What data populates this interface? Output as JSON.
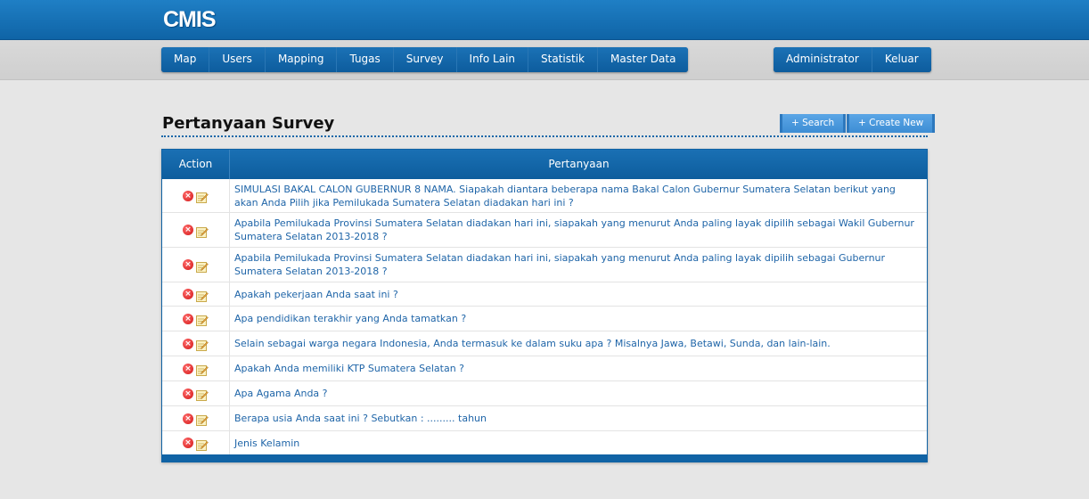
{
  "app": {
    "logo": "CMIS"
  },
  "nav": {
    "left": [
      "Map",
      "Users",
      "Mapping",
      "Tugas",
      "Survey",
      "Info Lain",
      "Statistik",
      "Master Data"
    ],
    "right": [
      "Administrator",
      "Keluar"
    ]
  },
  "page": {
    "title": "Pertanyaan Survey",
    "search_button": "+ Search",
    "create_button": "+ Create New"
  },
  "table": {
    "headers": {
      "action": "Action",
      "question": "Pertanyaan"
    },
    "rows": [
      "SIMULASI BAKAL CALON GUBERNUR 8 NAMA. Siapakah diantara beberapa nama Bakal Calon Gubernur Sumatera Selatan berikut yang akan Anda Pilih jika Pemilukada Sumatera Selatan diadakan hari ini ?",
      "Apabila Pemilukada Provinsi Sumatera Selatan diadakan hari ini, siapakah yang menurut Anda paling layak dipilih sebagai Wakil Gubernur Sumatera Selatan 2013-2018 ?",
      "Apabila Pemilukada Provinsi Sumatera Selatan diadakan hari ini, siapakah yang menurut Anda paling layak dipilih sebagai Gubernur Sumatera Selatan 2013-2018 ?",
      "Apakah pekerjaan Anda saat ini ?",
      "Apa pendidikan terakhir yang Anda tamatkan ?",
      "Selain sebagai warga negara Indonesia, Anda termasuk ke dalam suku apa ? Misalnya Jawa, Betawi, Sunda, dan lain-lain.",
      "Apakah Anda memiliki KTP Sumatera Selatan ?",
      "Apa Agama Anda ?",
      "Berapa usia Anda saat ini ? Sebutkan : ......... tahun",
      "Jenis Kelamin"
    ]
  },
  "icons": {
    "delete": "delete-icon",
    "edit": "edit-icon"
  },
  "colors": {
    "brand": "#1166aa",
    "link": "#1f65a8",
    "delete": "#d11414"
  }
}
